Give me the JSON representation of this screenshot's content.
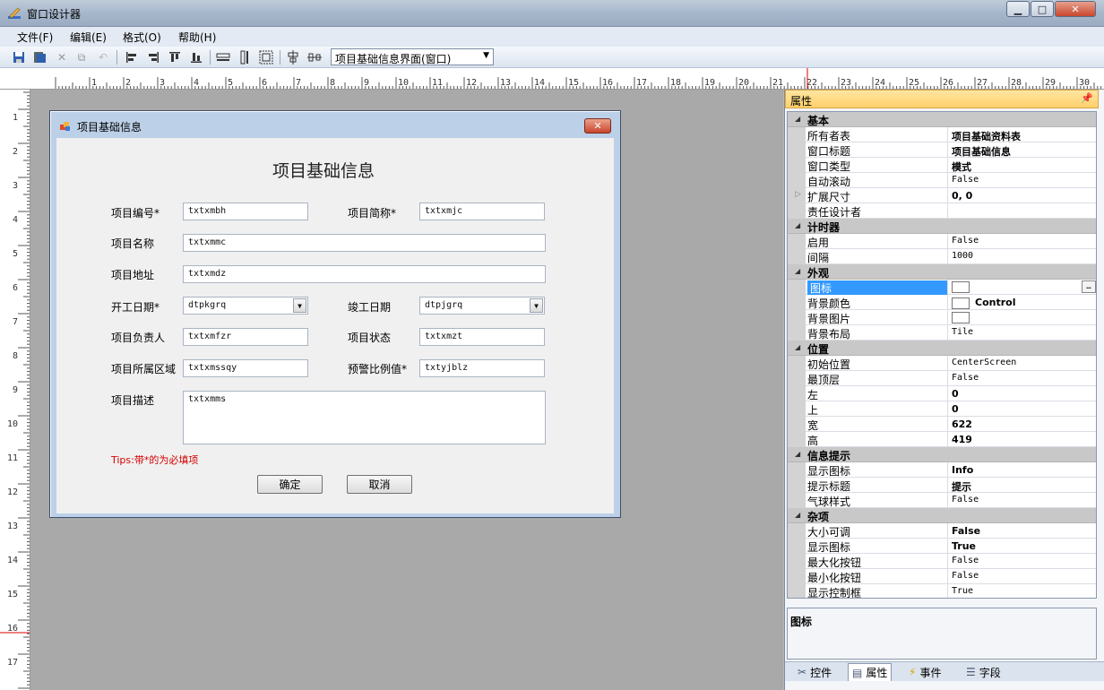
{
  "app": {
    "title": "窗口设计器",
    "window_controls": {
      "minimize": "▁",
      "maximize": "□",
      "close": "✕"
    }
  },
  "menu": [
    "文件(F)",
    "编辑(E)",
    "格式(O)",
    "帮助(H)"
  ],
  "toolbar": {
    "icons": [
      "save-icon",
      "save-all-icon",
      "cut-icon",
      "copy-icon",
      "undo-icon",
      "align-left-icon",
      "align-right-icon",
      "align-top-icon",
      "align-bottom-icon",
      "same-width-icon",
      "same-height-icon",
      "same-size-icon",
      "center-vertical-icon",
      "center-horizontal-icon"
    ],
    "selector_value": "项目基础信息界面(窗口)"
  },
  "ruler": {
    "h_labels": [
      "1",
      "2",
      "3",
      "4",
      "5",
      "6",
      "7",
      "8",
      "9",
      "10",
      "11",
      "12",
      "13",
      "14",
      "15",
      "16",
      "17",
      "18",
      "19",
      "20",
      "21",
      "22",
      "23",
      "24",
      "25",
      "26",
      "27",
      "28",
      "29",
      "30"
    ],
    "v_labels": [
      "1",
      "2",
      "3",
      "4",
      "5",
      "6",
      "7",
      "8",
      "9",
      "10",
      "11",
      "12",
      "13",
      "14",
      "15",
      "16",
      "17"
    ]
  },
  "form": {
    "window_title": "项目基础信息",
    "heading": "项目基础信息",
    "fields": {
      "xmbh": {
        "label": "项目编号*",
        "value": "txtxmbh"
      },
      "xmjc": {
        "label": "项目简称*",
        "value": "txtxmjc"
      },
      "xmmc": {
        "label": "项目名称",
        "value": "txtxmmc"
      },
      "xmdz": {
        "label": "项目地址",
        "value": "txtxmdz"
      },
      "kgrq": {
        "label": "开工日期*",
        "value": "dtpkgrq"
      },
      "jgrq": {
        "label": "竣工日期",
        "value": "dtpjgrq"
      },
      "xmfzr": {
        "label": "项目负责人",
        "value": "txtxmfzr"
      },
      "xmzt": {
        "label": "项目状态",
        "value": "txtxmzt"
      },
      "xmssqy": {
        "label": "项目所属区域",
        "value": "txtxmssqy"
      },
      "yjblz": {
        "label": "预警比例值*",
        "value": "txtyjblz"
      },
      "xmms": {
        "label": "项目描述",
        "value": "txtxmms"
      }
    },
    "tips": "Tips:带*的为必填项",
    "ok_label": "确定",
    "cancel_label": "取消"
  },
  "properties": {
    "header": "属性",
    "categories": {
      "basic": {
        "name": "基本",
        "rows": [
          {
            "name": "所有者表",
            "value": "项目基础资料表"
          },
          {
            "name": "窗口标题",
            "value": "项目基础信息"
          },
          {
            "name": "窗口类型",
            "value": "模式"
          },
          {
            "name": "自动滚动",
            "value": "False"
          },
          {
            "name": "扩展尺寸",
            "value": "0, 0"
          },
          {
            "name": "责任设计者",
            "value": ""
          }
        ]
      },
      "timer": {
        "name": "计时器",
        "rows": [
          {
            "name": "启用",
            "value": "False"
          },
          {
            "name": "间隔",
            "value": "1000"
          }
        ]
      },
      "appearance": {
        "name": "外观",
        "rows": [
          {
            "name": "图标",
            "value": ""
          },
          {
            "name": "背景颜色",
            "value": "Control"
          },
          {
            "name": "背景图片",
            "value": ""
          },
          {
            "name": "背景布局",
            "value": "Tile"
          }
        ]
      },
      "position": {
        "name": "位置",
        "rows": [
          {
            "name": "初始位置",
            "value": "CenterScreen"
          },
          {
            "name": "最顶层",
            "value": "False"
          },
          {
            "name": "左",
            "value": "0"
          },
          {
            "name": "上",
            "value": "0"
          },
          {
            "name": "宽",
            "value": "622"
          },
          {
            "name": "高",
            "value": "419"
          }
        ]
      },
      "tooltip": {
        "name": "信息提示",
        "rows": [
          {
            "name": "显示图标",
            "value": "Info"
          },
          {
            "name": "提示标题",
            "value": "提示"
          },
          {
            "name": "气球样式",
            "value": "False"
          }
        ]
      },
      "misc": {
        "name": "杂项",
        "rows": [
          {
            "name": "大小可调",
            "value": "False"
          },
          {
            "name": "显示图标",
            "value": "True"
          },
          {
            "name": "最大化按钮",
            "value": "False"
          },
          {
            "name": "最小化按钮",
            "value": "False"
          },
          {
            "name": "显示控制框",
            "value": "True"
          }
        ]
      }
    },
    "description_title": "图标",
    "tabs": [
      "控件",
      "属性",
      "事件",
      "字段"
    ]
  }
}
